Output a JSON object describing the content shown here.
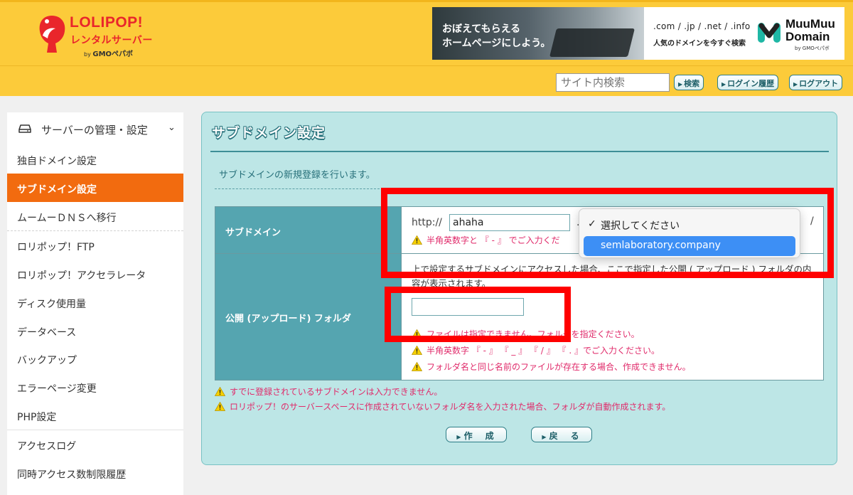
{
  "header": {
    "logo_name": "LOLIPOP!",
    "logo_sub": "レンタルサーバー",
    "logo_by": "by",
    "logo_by_brand": "GMOペパボ",
    "ad_left_line1": "おぼえてもらえる",
    "ad_left_line2": "ホームページにしよう。",
    "ad_right_domains": ".com / .jp / .net / .info",
    "ad_right_tagline": "人気のドメインを今すぐ検索",
    "ad_right_brand_line1": "MuuMuu",
    "ad_right_brand_line2": "Domain",
    "ad_right_by": "by GMOペパボ",
    "search_placeholder": "サイト内検索",
    "btn_search": "検索",
    "btn_login_history": "ログイン履歴",
    "btn_logout": "ログアウト",
    "colors": {
      "header_bg": "#fccb3a",
      "logo_red": "#e9262b"
    }
  },
  "sidebar": {
    "section_icon": "server-icon",
    "section_label": "サーバーの管理・設定",
    "items": [
      {
        "label": "独自ドメイン設定"
      },
      {
        "label": "サブドメイン設定",
        "active": true
      },
      {
        "label": "ムームーＤＮＳへ移行"
      },
      {
        "label": "ロリポップ！FTP"
      },
      {
        "label": "ロリポップ！アクセラレータ"
      },
      {
        "label": "ディスク使用量"
      },
      {
        "label": "データベース"
      },
      {
        "label": "バックアップ"
      },
      {
        "label": "エラーページ変更"
      },
      {
        "label": "PHP設定"
      },
      {
        "label": "アクセスログ"
      },
      {
        "label": "同時アクセス数制限履歴"
      }
    ],
    "colors": {
      "active_bg": "#f26b0f"
    }
  },
  "main": {
    "title": "サブドメイン設定",
    "description": "サブドメインの新規登録を行います。",
    "subdomain_label": "サブドメイン",
    "url_prefix": "http://",
    "subdomain_value": "ahaha",
    "dot": ".",
    "slash": "/",
    "subdomain_warning": "半角英数字と 『 - 』 でご入力くだ",
    "folder_label": "公開 (アップロード) フォルダ",
    "folder_info": "上で設定するサブドメインにアクセスした場合、ここで指定した公開 ( アップロード ) フォルダの内容が表示されます。",
    "folder_value": "",
    "folder_warnings": [
      "ファイルは指定できません。フォルダを指定ください。",
      "半角英数字 『 - 』 『 _ 』 『 / 』 『 . 』でご入力ください。",
      "フォルダ名と同じ名前のファイルが存在する場合、作成できません。"
    ],
    "notes": [
      "すでに登録されているサブドメインは入力できません。",
      "ロリポップ！のサーバースペースに作成されていないフォルダ名を入力された場合、フォルダが自動作成されます。"
    ],
    "btn_create": "作　成",
    "btn_back": "戻　る",
    "colors": {
      "panel_bg": "#bde6e6",
      "label_cell": "#55a5b0",
      "warning": "#e02a6a"
    }
  },
  "dropdown": {
    "options": [
      "選択してください",
      "semlaboratory.company"
    ],
    "selected_index": 0,
    "highlighted_index": 1,
    "check_icon": "checkmark-icon",
    "colors": {
      "highlight": "#3d8ff5"
    }
  },
  "annotations": {
    "color": "#ff0000"
  }
}
